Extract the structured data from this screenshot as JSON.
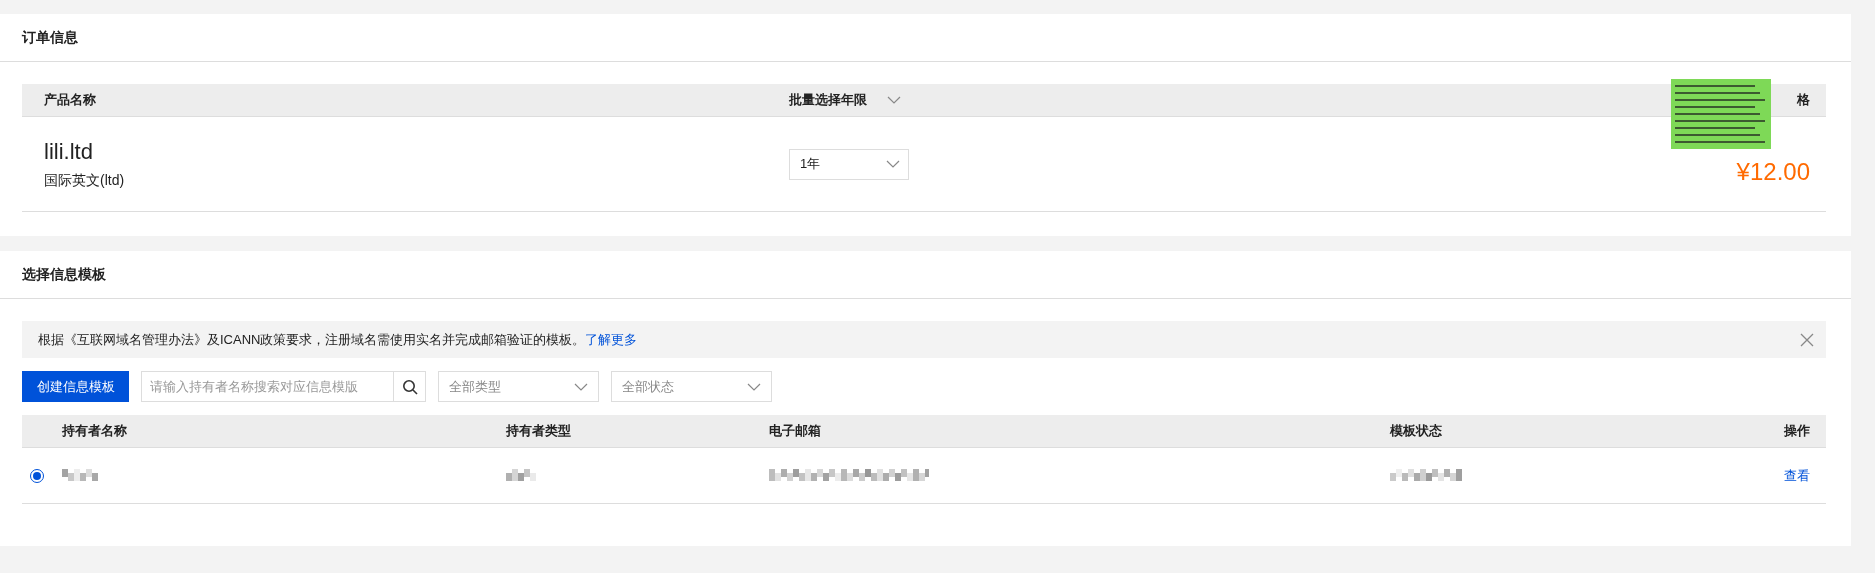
{
  "order_section": {
    "title": "订单信息",
    "table": {
      "columns": [
        {
          "label": "产品名称"
        },
        {
          "label": "批量选择年限"
        },
        {
          "label": "格"
        }
      ],
      "rows": [
        {
          "domain": "lili.ltd",
          "subtitle": "国际英文(ltd)",
          "period": "1年",
          "price": "¥12.00"
        }
      ]
    }
  },
  "template_section": {
    "title": "选择信息模板",
    "notice": {
      "text": "根据《互联网域名管理办法》及ICANN政策要求，注册域名需使用实名并完成邮箱验证的模板。",
      "link": "了解更多"
    },
    "create_button": "创建信息模板",
    "search": {
      "placeholder": "请输入持有者名称搜索对应信息模版"
    },
    "filters": [
      {
        "value": "全部类型"
      },
      {
        "value": "全部状态"
      }
    ],
    "table": {
      "columns": [
        "持有者名称",
        "持有者类型",
        "电子邮箱",
        "模板状态",
        "操作"
      ],
      "rows": [
        {
          "selected": true,
          "action": "查看"
        }
      ]
    }
  }
}
